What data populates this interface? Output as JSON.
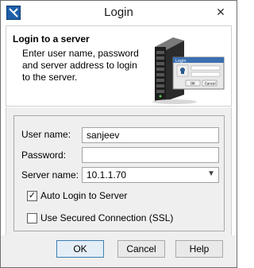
{
  "window": {
    "title": "Login",
    "close_glyph": "✕"
  },
  "header": {
    "title": "Login to a server",
    "description": "Enter user name, password and server address to login to the server.",
    "illustration": {
      "dialog_title": "Login",
      "ok_label": "OK",
      "cancel_label": "Cancel"
    }
  },
  "form": {
    "username": {
      "label": "User name:",
      "value": "sanjeev"
    },
    "password": {
      "label": "Password:",
      "value": ""
    },
    "server": {
      "label": "Server name:",
      "value": "10.1.1.70"
    },
    "auto_login": {
      "label": "Auto Login to Server",
      "checked": true
    },
    "ssl": {
      "label": "Use Secured Connection (SSL)",
      "checked": false
    }
  },
  "buttons": {
    "ok": "OK",
    "cancel": "Cancel",
    "help": "Help"
  },
  "icons": {
    "app": "app-icon",
    "close": "close-icon",
    "dropdown": "chevron-down-icon",
    "check": "checkmark-icon"
  },
  "colors": {
    "accent": "#3c7fb1",
    "window_bg": "#efefef"
  }
}
